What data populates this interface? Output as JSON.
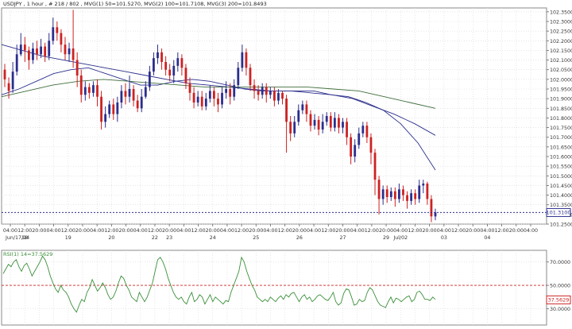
{
  "chart_data": [
    {
      "type": "candlestick",
      "title": "USDJPY , 1 hour , # 218 / 802 , MVG(1) 50=101.5270, MVG(2) 100=101.7108, MVG(3) 200=101.8493",
      "ylim": [
        101.25,
        102.37
      ],
      "price_ticks": [
        "102.3500",
        "102.3000",
        "102.2500",
        "102.2000",
        "102.1500",
        "102.1000",
        "102.0500",
        "102.0000",
        "101.9500",
        "101.9000",
        "101.8500",
        "101.8000",
        "101.7500",
        "101.7000",
        "101.6500",
        "101.6000",
        "101.5500",
        "101.5000",
        "101.4500",
        "101.4000",
        "101.3500",
        "101.3000",
        "101.2500"
      ],
      "last_price_label": "101.3100",
      "last_price": 101.31,
      "time_ticks": [
        "04:00",
        "12:00",
        "20:00",
        "04:00",
        "12:00",
        "20:00",
        "04:00",
        "12:00",
        "20:00",
        "04:00",
        "12:00",
        "20:00",
        "04:00",
        "12:00",
        "20:00",
        "04:00",
        "12:00",
        "20:00",
        "04:00",
        "12:00",
        "20:00",
        "04:00",
        "12:00",
        "20:00",
        "04:00",
        "12:00",
        "20:00",
        "04:00",
        "12:00",
        "20:00",
        "04:00",
        "12:00",
        "20:00",
        "04:00",
        "12:00",
        "20:00",
        "04:00"
      ],
      "date_labels": [
        "Jun/17/14",
        "18",
        "19",
        "20",
        "22",
        "23",
        "24",
        "25",
        "26",
        "27",
        "29",
        "Jul/02",
        "03",
        "04"
      ],
      "bars": [
        [
          102.05,
          102.0,
          102.08,
          101.96
        ],
        [
          101.98,
          101.94,
          102.01,
          101.9
        ],
        [
          101.95,
          102.04,
          102.09,
          101.93
        ],
        [
          102.04,
          102.13,
          102.18,
          102.02
        ],
        [
          102.13,
          102.18,
          102.24,
          102.12
        ],
        [
          102.18,
          102.15,
          102.22,
          102.09
        ],
        [
          102.15,
          102.1,
          102.17,
          102.05
        ],
        [
          102.1,
          102.16,
          102.19,
          102.08
        ],
        [
          102.16,
          102.13,
          102.2,
          102.1
        ],
        [
          102.13,
          102.17,
          102.21,
          102.11
        ],
        [
          102.17,
          102.12,
          102.19,
          102.09
        ],
        [
          102.12,
          102.2,
          102.24,
          102.1
        ],
        [
          102.2,
          102.27,
          102.32,
          102.18
        ],
        [
          102.27,
          102.24,
          102.3,
          102.2
        ],
        [
          102.24,
          102.18,
          102.26,
          102.14
        ],
        [
          102.18,
          102.13,
          102.22,
          102.1
        ],
        [
          102.13,
          102.16,
          102.19,
          102.09
        ],
        [
          102.16,
          102.1,
          102.36,
          102.06
        ],
        [
          102.1,
          102.02,
          102.14,
          101.96
        ],
        [
          102.02,
          101.92,
          102.05,
          101.88
        ],
        [
          101.92,
          101.96,
          101.99,
          101.89
        ],
        [
          101.96,
          101.93,
          101.98,
          101.9
        ],
        [
          101.93,
          101.97,
          101.99,
          101.91
        ],
        [
          101.97,
          101.91,
          102.0,
          101.86
        ],
        [
          101.91,
          101.78,
          101.94,
          101.74
        ],
        [
          101.78,
          101.82,
          101.86,
          101.75
        ],
        [
          101.82,
          101.87,
          101.89,
          101.8
        ],
        [
          101.87,
          101.82,
          101.9,
          101.79
        ],
        [
          101.82,
          101.88,
          101.91,
          101.78
        ],
        [
          101.88,
          101.94,
          101.97,
          101.85
        ],
        [
          101.94,
          101.91,
          101.98,
          101.87
        ],
        [
          101.91,
          101.95,
          102.02,
          101.88
        ],
        [
          101.95,
          101.89,
          101.97,
          101.86
        ],
        [
          101.89,
          101.85,
          101.92,
          101.83
        ],
        [
          101.85,
          101.91,
          101.95,
          101.83
        ],
        [
          101.91,
          101.96,
          101.99,
          101.9
        ],
        [
          101.96,
          102.04,
          102.07,
          101.94
        ],
        [
          102.04,
          102.11,
          102.14,
          102.02
        ],
        [
          102.11,
          102.14,
          102.18,
          102.08
        ],
        [
          102.14,
          102.09,
          102.16,
          102.05
        ],
        [
          102.09,
          102.05,
          102.12,
          102.02
        ],
        [
          102.05,
          102.02,
          102.08,
          101.99
        ],
        [
          102.02,
          102.07,
          102.1,
          101.98
        ],
        [
          102.07,
          102.11,
          102.14,
          102.04
        ],
        [
          102.11,
          102.06,
          102.13,
          102.02
        ],
        [
          102.06,
          101.98,
          102.08,
          101.95
        ],
        [
          101.98,
          101.93,
          102.01,
          101.89
        ],
        [
          101.93,
          101.88,
          101.96,
          101.85
        ],
        [
          101.88,
          101.91,
          101.94,
          101.86
        ],
        [
          101.91,
          101.86,
          101.94,
          101.84
        ],
        [
          101.86,
          101.9,
          101.93,
          101.84
        ],
        [
          101.9,
          101.94,
          101.97,
          101.88
        ],
        [
          101.94,
          101.9,
          101.96,
          101.86
        ],
        [
          101.9,
          101.87,
          101.93,
          101.83
        ],
        [
          101.87,
          101.93,
          101.96,
          101.85
        ],
        [
          101.93,
          101.95,
          101.99,
          101.9
        ],
        [
          101.95,
          101.91,
          101.98,
          101.87
        ],
        [
          101.91,
          101.97,
          102.0,
          101.89
        ],
        [
          101.97,
          102.06,
          102.09,
          101.95
        ],
        [
          102.06,
          102.14,
          102.18,
          102.04
        ],
        [
          102.14,
          102.06,
          102.16,
          102.02
        ],
        [
          102.06,
          101.97,
          102.08,
          101.94
        ],
        [
          101.97,
          101.94,
          102.0,
          101.9
        ],
        [
          101.94,
          101.92,
          101.97,
          101.89
        ],
        [
          101.92,
          101.96,
          101.98,
          101.9
        ],
        [
          101.96,
          101.92,
          101.98,
          101.88
        ],
        [
          101.92,
          101.94,
          101.96,
          101.9
        ],
        [
          101.94,
          101.89,
          101.96,
          101.86
        ],
        [
          101.89,
          101.93,
          101.95,
          101.87
        ],
        [
          101.93,
          101.9,
          101.94,
          101.87
        ],
        [
          101.9,
          101.78,
          101.92,
          101.62
        ],
        [
          101.78,
          101.72,
          101.81,
          101.68
        ],
        [
          101.72,
          101.78,
          101.81,
          101.7
        ],
        [
          101.78,
          101.84,
          101.87,
          101.76
        ],
        [
          101.84,
          101.87,
          101.89,
          101.82
        ],
        [
          101.87,
          101.82,
          101.89,
          101.78
        ],
        [
          101.82,
          101.76,
          101.84,
          101.73
        ],
        [
          101.76,
          101.79,
          101.82,
          101.74
        ],
        [
          101.79,
          101.74,
          101.81,
          101.71
        ],
        [
          101.74,
          101.78,
          101.82,
          101.72
        ],
        [
          101.78,
          101.81,
          101.83,
          101.76
        ],
        [
          101.81,
          101.75,
          101.83,
          101.73
        ],
        [
          101.75,
          101.8,
          101.83,
          101.73
        ],
        [
          101.8,
          101.75,
          101.82,
          101.72
        ],
        [
          101.75,
          101.78,
          101.8,
          101.72
        ],
        [
          101.78,
          101.7,
          101.8,
          101.66
        ],
        [
          101.7,
          101.6,
          101.72,
          101.56
        ],
        [
          101.6,
          101.66,
          101.69,
          101.57
        ],
        [
          101.66,
          101.72,
          101.75,
          101.64
        ],
        [
          101.72,
          101.76,
          101.78,
          101.7
        ],
        [
          101.76,
          101.7,
          101.78,
          101.67
        ],
        [
          101.7,
          101.62,
          101.72,
          101.56
        ],
        [
          101.62,
          101.48,
          101.64,
          101.4
        ],
        [
          101.48,
          101.38,
          101.5,
          101.3
        ],
        [
          101.38,
          101.43,
          101.45,
          101.35
        ],
        [
          101.43,
          101.39,
          101.45,
          101.36
        ],
        [
          101.39,
          101.42,
          101.44,
          101.37
        ],
        [
          101.42,
          101.38,
          101.44,
          101.34
        ],
        [
          101.38,
          101.43,
          101.46,
          101.36
        ],
        [
          101.43,
          101.4,
          101.45,
          101.37
        ],
        [
          101.4,
          101.37,
          101.42,
          101.33
        ],
        [
          101.37,
          101.41,
          101.43,
          101.35
        ],
        [
          101.41,
          101.38,
          101.43,
          101.35
        ],
        [
          101.38,
          101.45,
          101.48,
          101.36
        ],
        [
          101.45,
          101.46,
          101.48,
          101.41
        ],
        [
          101.46,
          101.38,
          101.47,
          101.35
        ],
        [
          101.38,
          101.29,
          101.4,
          101.26
        ],
        [
          101.29,
          101.31,
          101.33,
          101.27
        ]
      ],
      "moving_averages": [
        {
          "name": "MVG(1) 50",
          "color": "#2b2e8c",
          "start": 0,
          "values": [
            101.92,
            101.95,
            101.99,
            102.03,
            102.05,
            102.06,
            102.03,
            102.0,
            101.97,
            101.97,
            101.99,
            102.0,
            101.99,
            101.97,
            101.95,
            101.94,
            101.94,
            101.94,
            101.94,
            101.92,
            101.91,
            101.88,
            101.84,
            101.77,
            101.67,
            101.53
          ]
        },
        {
          "name": "MVG(2) 100",
          "color": "#2b2e8c",
          "start": 0,
          "values": [
            102.18,
            102.15,
            102.12,
            102.1,
            102.08,
            102.06,
            102.04,
            102.02,
            102.0,
            101.98,
            101.97,
            101.96,
            101.95,
            101.94,
            101.94,
            101.93,
            101.92,
            101.9,
            101.86,
            101.82,
            101.77,
            101.71
          ]
        },
        {
          "name": "MVG(3) 200",
          "color": "#3f6d3c",
          "start": 0,
          "values": [
            101.91,
            101.94,
            101.97,
            101.99,
            102.0,
            101.99,
            101.98,
            101.97,
            101.96,
            101.96,
            101.96,
            101.96,
            101.96,
            101.95,
            101.94,
            101.91,
            101.88,
            101.85
          ]
        }
      ]
    },
    {
      "type": "line",
      "title": "RSI(1) 14=37.5629",
      "ylim": [
        16,
        80
      ],
      "ticks": [
        "70.0000",
        "50.0000",
        "30.0000"
      ],
      "levels": [
        70,
        50,
        30
      ],
      "last_label": "37.5629",
      "series": [
        {
          "name": "RSI(1) 14",
          "color": "#3a8f3a",
          "values": [
            60,
            64,
            68,
            66,
            70,
            72,
            66,
            62,
            67,
            69,
            64,
            58,
            62,
            66,
            70,
            75,
            72,
            66,
            58,
            52,
            47,
            44,
            50,
            46,
            44,
            40,
            34,
            30,
            27,
            33,
            38,
            36,
            44,
            48,
            55,
            50,
            45,
            48,
            52,
            48,
            42,
            38,
            40,
            45,
            52,
            58,
            56,
            50,
            46,
            40,
            38,
            36,
            44,
            40,
            36,
            40,
            46,
            52,
            62,
            72,
            74,
            70,
            64,
            56,
            50,
            44,
            40,
            38,
            40,
            36,
            34,
            40,
            44,
            36,
            38,
            42,
            40,
            34,
            38,
            42,
            36,
            40,
            38,
            36,
            34,
            37,
            36,
            44,
            50,
            56,
            62,
            74,
            70,
            62,
            56,
            50,
            46,
            40,
            38,
            36,
            38,
            36,
            40,
            38,
            36,
            39,
            41,
            38,
            42,
            40,
            43,
            44,
            40,
            36,
            40,
            42,
            38,
            40,
            36,
            38,
            41,
            42,
            40,
            38,
            37,
            40,
            44,
            36,
            33,
            35,
            43,
            47,
            46,
            40,
            33,
            34,
            38,
            36,
            37,
            44,
            48,
            46,
            41,
            36,
            33,
            32,
            31,
            36,
            40,
            35,
            39,
            38,
            36,
            38,
            40,
            41,
            36,
            38,
            44,
            45,
            42,
            38,
            38,
            37,
            40,
            38
          ]
        }
      ]
    }
  ]
}
